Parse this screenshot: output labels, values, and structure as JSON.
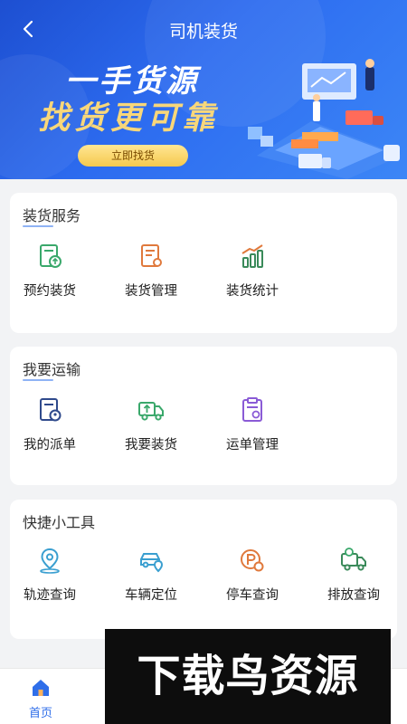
{
  "header": {
    "title": "司机装货",
    "slogan_line1": "一手货源",
    "slogan_line2": "找货更可靠",
    "cta_label": "立即找货"
  },
  "sections": [
    {
      "title": "装货服务",
      "items": [
        {
          "label": "预约装货",
          "icon": "schedule-loading-icon"
        },
        {
          "label": "装货管理",
          "icon": "loading-management-icon"
        },
        {
          "label": "装货统计",
          "icon": "loading-stats-icon"
        }
      ]
    },
    {
      "title": "我要运输",
      "items": [
        {
          "label": "我的派单",
          "icon": "my-dispatch-icon"
        },
        {
          "label": "我要装货",
          "icon": "truck-load-icon"
        },
        {
          "label": "运单管理",
          "icon": "waybill-management-icon"
        }
      ]
    },
    {
      "title": "快捷小工具",
      "items": [
        {
          "label": "轨迹查询",
          "icon": "location-pin-icon"
        },
        {
          "label": "车辆定位",
          "icon": "car-locate-icon"
        },
        {
          "label": "停车查询",
          "icon": "parking-icon"
        },
        {
          "label": "排放查询",
          "icon": "emission-truck-icon"
        }
      ]
    }
  ],
  "tabbar": {
    "home_label": "首页",
    "home_icon": "home-icon"
  },
  "watermark": "下载鸟资源",
  "colors": {
    "header_blue": "#2d6cf0",
    "accent_green": "#3aa86b",
    "accent_orange": "#e0793c",
    "accent_purple": "#8a5bd6",
    "accent_navy": "#2f4a8c",
    "accent_teal": "#3a9fd0",
    "cta_yellow": "#f5c94e"
  }
}
